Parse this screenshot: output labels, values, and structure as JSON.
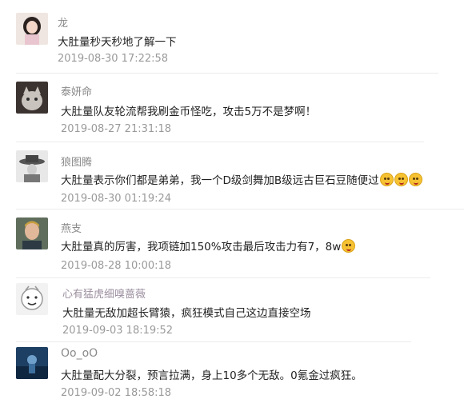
{
  "comments": [
    {
      "name": "龙",
      "text": "大肚量秒天秒地了解一下",
      "time": "2019-08-30 17:22:58",
      "emoji_count": 0,
      "avatar": "girl-avatar"
    },
    {
      "name": "泰妍命",
      "text": "大肚量队友轮流帮我刷金币怪吃，攻击5万不是梦啊！",
      "time": "2019-08-27 21:31:18",
      "emoji_count": 0,
      "avatar": "cat-avatar"
    },
    {
      "name": "狼图腾",
      "text": "大肚量表示你们都是弟弟，我一个D级剑舞加B级远古巨石豆随便过",
      "time": "2019-08-30 01:19:24",
      "emoji_count": 3,
      "avatar": "hat-avatar"
    },
    {
      "name": "燕支",
      "text": "大肚量真的厉害，我项链加150%攻击最后攻击力有7，8w",
      "time": "2019-08-28 10:00:18",
      "emoji_count": 1,
      "avatar": "man-avatar"
    },
    {
      "name": "心有猛虎细嗅蔷薇",
      "text": "大肚量无敌加超长臂猿，疯狂模式自己这边直接空场",
      "time": "2019-09-03 18:19:52",
      "emoji_count": 0,
      "avatar": "cartoon-avatar"
    },
    {
      "name": "Oo_oO",
      "text": "大肚量配大分裂，预言拉满，身上10多个无敌。0氪金过疯狂。",
      "time": "2019-09-02 18:58:18",
      "emoji_count": 0,
      "avatar": "blue-avatar"
    }
  ]
}
